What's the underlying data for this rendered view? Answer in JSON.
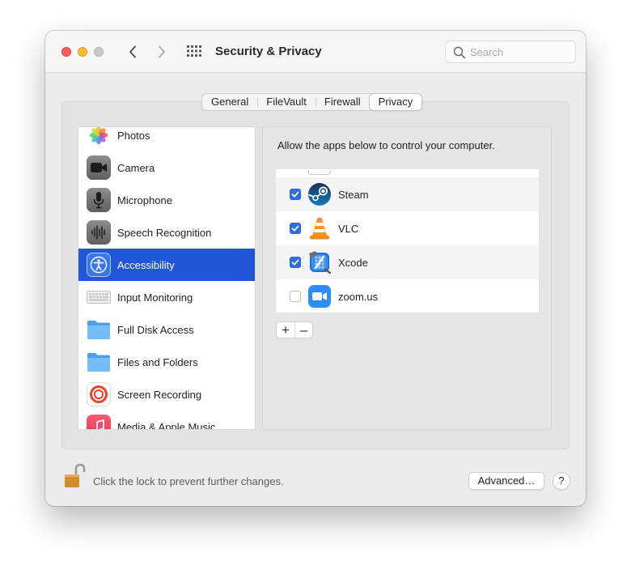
{
  "window": {
    "title": "Security & Privacy",
    "search_placeholder": "Search"
  },
  "tabs": [
    {
      "label": "General",
      "active": false
    },
    {
      "label": "FileVault",
      "active": false
    },
    {
      "label": "Firewall",
      "active": false
    },
    {
      "label": "Privacy",
      "active": true
    }
  ],
  "sidebar": {
    "selected": "Accessibility",
    "items": [
      {
        "label": "Photos",
        "icon": "photos-icon"
      },
      {
        "label": "Camera",
        "icon": "camera-icon"
      },
      {
        "label": "Microphone",
        "icon": "microphone-icon"
      },
      {
        "label": "Speech Recognition",
        "icon": "waveform-icon"
      },
      {
        "label": "Accessibility",
        "icon": "accessibility-icon"
      },
      {
        "label": "Input Monitoring",
        "icon": "keyboard-icon"
      },
      {
        "label": "Full Disk Access",
        "icon": "folder-icon"
      },
      {
        "label": "Files and Folders",
        "icon": "folder-icon"
      },
      {
        "label": "Screen Recording",
        "icon": "screen-recording-icon"
      },
      {
        "label": "Media & Apple Music",
        "icon": "music-icon"
      }
    ]
  },
  "content": {
    "description": "Allow the apps below to control your computer.",
    "apps": [
      {
        "name": "Steam",
        "checked": true,
        "icon": "steam-icon"
      },
      {
        "name": "VLC",
        "checked": true,
        "icon": "vlc-icon"
      },
      {
        "name": "Xcode",
        "checked": true,
        "icon": "xcode-icon"
      },
      {
        "name": "zoom.us",
        "checked": false,
        "icon": "zoom-icon"
      }
    ],
    "add_label": "+",
    "remove_label": "–"
  },
  "footer": {
    "lock_text": "Click the lock to prevent further changes.",
    "advanced_label": "Advanced…",
    "help_label": "?"
  },
  "colors": {
    "selection": "#2156d6",
    "checkbox": "#2f6fe0"
  }
}
